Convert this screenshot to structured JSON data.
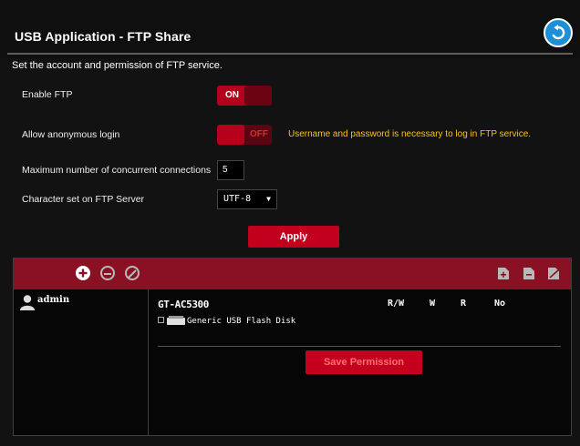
{
  "header": {
    "title": "USB Application - FTP Share",
    "subtitle": "Set the account and permission of FTP service."
  },
  "settings": {
    "enable_ftp": {
      "label": "Enable FTP",
      "state": "ON"
    },
    "anonymous": {
      "label": "Allow anonymous login",
      "state": "OFF",
      "warning": "Username and password is necessary to log in FTP service."
    },
    "max_conn": {
      "label": "Maximum number of concurrent connections",
      "value": "5"
    },
    "charset": {
      "label": "Character set on FTP Server",
      "value": "UTF-8"
    },
    "apply_label": "Apply"
  },
  "permissions": {
    "users": [
      {
        "name": "admin"
      }
    ],
    "device": "GT-AC5300",
    "columns": [
      "R/W",
      "W",
      "R",
      "No"
    ],
    "disk": "Generic USB Flash Disk",
    "save_label": "Save Permission"
  },
  "colors": {
    "accent": "#c2001e",
    "header_bar": "#8a1024",
    "warning": "#ffc400",
    "back_button": "#1e8fd6"
  },
  "icons": {
    "back": "back-arrow-icon",
    "add": "add-user-icon",
    "remove": "remove-user-icon",
    "ban": "ban-icon",
    "folders": [
      "add-folder-icon",
      "edit-folder-icon",
      "delete-folder-icon"
    ],
    "user": "user-avatar-icon",
    "disk": "usb-disk-icon"
  }
}
